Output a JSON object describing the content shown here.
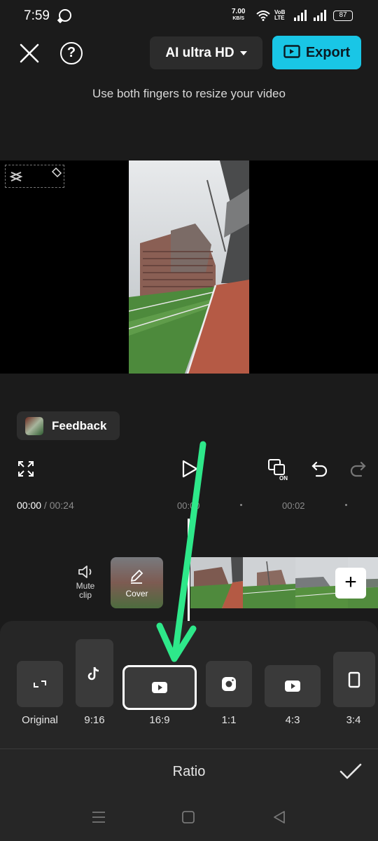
{
  "status_bar": {
    "time": "7:59",
    "speed_value": "7.00",
    "speed_unit": "KB/S",
    "volte_top": "VoB",
    "volte_bottom": "LTE",
    "battery": "87"
  },
  "top_bar": {
    "quality_label": "AI ultra HD",
    "export_label": "Export",
    "hint": "Use both fingers to resize your video"
  },
  "feedback": {
    "label": "Feedback"
  },
  "playback": {
    "current_time": "00:00",
    "separator": " / ",
    "duration": "00:24",
    "tick_1": "00:00",
    "tick_2": "00:02"
  },
  "timeline": {
    "mute_line1": "Mute",
    "mute_line2": "clip",
    "cover_label": "Cover"
  },
  "ratio_panel": {
    "title": "Ratio",
    "options": [
      {
        "label": "Original",
        "icon": "expand-icon",
        "selected": false
      },
      {
        "label": "9:16",
        "icon": "tiktok-icon",
        "selected": false
      },
      {
        "label": "16:9",
        "icon": "youtube-icon",
        "selected": true
      },
      {
        "label": "1:1",
        "icon": "instagram-icon",
        "selected": false
      },
      {
        "label": "4:3",
        "icon": "youtube-icon",
        "selected": false
      },
      {
        "label": "3:4",
        "icon": "portrait-rect-icon",
        "selected": false
      }
    ]
  },
  "colors": {
    "export_accent": "#19c6e6",
    "annotation_arrow": "#2ee88a",
    "background": "#1b1b1b",
    "panel": "#262626"
  }
}
